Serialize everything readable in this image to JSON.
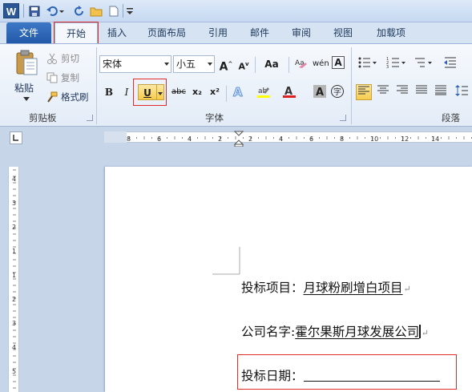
{
  "qat": {
    "app_icon": "W",
    "buttons": [
      "save-icon",
      "undo-icon",
      "redo-icon",
      "open-icon",
      "new-icon",
      "customize-icon"
    ]
  },
  "tabs": [
    {
      "label": "文件"
    },
    {
      "label": "开始"
    },
    {
      "label": "插入"
    },
    {
      "label": "页面布局"
    },
    {
      "label": "引用"
    },
    {
      "label": "邮件"
    },
    {
      "label": "审阅"
    },
    {
      "label": "视图"
    },
    {
      "label": "加载项"
    }
  ],
  "clipboard": {
    "paste_label": "粘贴",
    "cut_label": "剪切",
    "copy_label": "复制",
    "format_painter_label": "格式刷",
    "group_label": "剪贴板"
  },
  "font": {
    "font_name": "宋体",
    "font_size": "小五",
    "grow_label": "A",
    "shrink_label": "A",
    "case_label": "Aa",
    "wen_label": "wén",
    "bold_label": "B",
    "italic_label": "I",
    "underline_label": "U",
    "strike_label": "abc",
    "sub_label": "x₂",
    "sup_label": "x²",
    "group_label": "字体"
  },
  "paragraph": {
    "group_label": "段落"
  },
  "ruler_marks": [
    "8",
    "6",
    "4",
    "2",
    "2",
    "4",
    "6",
    "8",
    "10",
    "12",
    "14"
  ],
  "vruler_marks": [
    "4",
    "3",
    "2",
    "1",
    "1",
    "2",
    "3",
    "4",
    "5"
  ],
  "document": {
    "line1_label": "投标项目：",
    "line1_value": "月球粉刷增白项目",
    "line2_label": "公司名字:",
    "line2_value": "霍尔果斯月球发展公司",
    "line3_label": "投标日期：",
    "para_mark": "↵"
  },
  "colors": {
    "accent": "#2b5797",
    "highlight": "#f7cb4c",
    "red_outline": "#e02b2b"
  }
}
